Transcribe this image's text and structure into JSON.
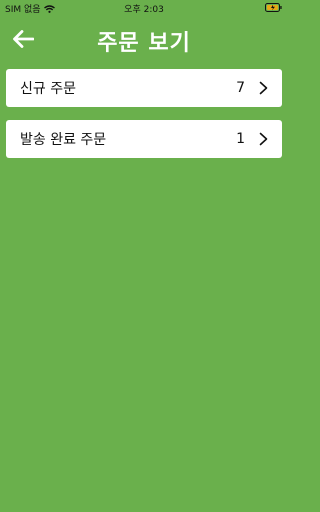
{
  "status_bar": {
    "carrier": "SIM 없음",
    "time": "오후 2:03",
    "icons": [
      "wifi-icon",
      "battery-icon"
    ]
  },
  "header": {
    "title": "주문 보기",
    "back_icon": "arrow-left-icon"
  },
  "orders": [
    {
      "label": "신규 주문",
      "count": "7"
    },
    {
      "label": "발송 완료 주문",
      "count": "1"
    }
  ],
  "colors": {
    "background": "#6ab04c",
    "card": "#ffffff",
    "title": "#ffffff"
  }
}
